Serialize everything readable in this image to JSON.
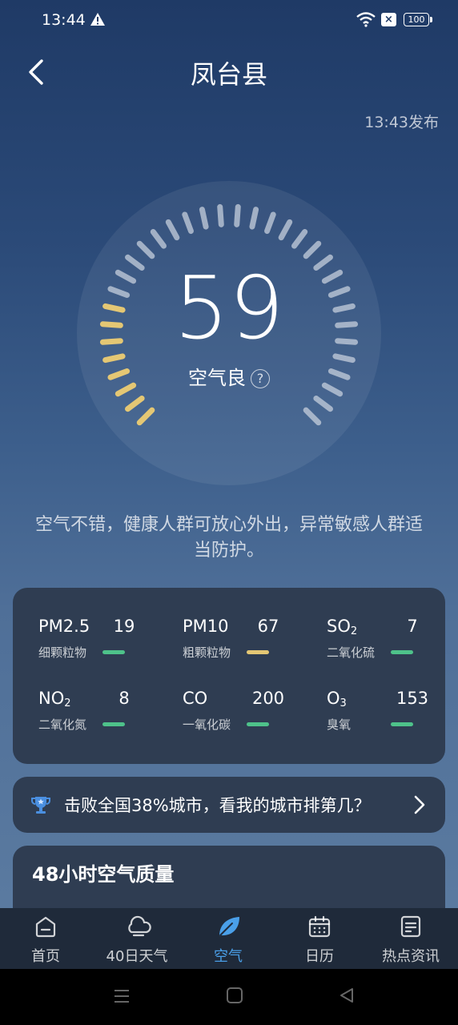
{
  "status_bar": {
    "time": "13:44",
    "battery": "100"
  },
  "header": {
    "title": "凤台县",
    "publish_time": "13:43发布"
  },
  "aqi": {
    "value": "59",
    "level": "空气良",
    "help": "?"
  },
  "advice": "空气不错，健康人群可放心外出，异常敏感人群适当防护。",
  "pollutants": [
    {
      "name": "PM2.5",
      "sub": "",
      "value": "19",
      "cn": "细颗粒物",
      "color": "#4ec28a"
    },
    {
      "name": "PM10",
      "sub": "",
      "value": "67",
      "cn": "粗颗粒物",
      "color": "#e4c774"
    },
    {
      "name": "SO",
      "sub": "2",
      "value": "7",
      "cn": "二氧化硫",
      "color": "#4ec28a"
    },
    {
      "name": "NO",
      "sub": "2",
      "value": "8",
      "cn": "二氧化氮",
      "color": "#4ec28a"
    },
    {
      "name": "CO",
      "sub": "",
      "value": "200",
      "cn": "一氧化碳",
      "color": "#4ec28a"
    },
    {
      "name": "O",
      "sub": "3",
      "value": "153",
      "cn": "臭氧",
      "color": "#4ec28a"
    }
  ],
  "rank": {
    "text": "击败全国38%城市，看我的城市排第几？"
  },
  "hours_card": {
    "title": "48小时空气质量"
  },
  "nav": [
    {
      "label": "首页",
      "icon": "home-icon"
    },
    {
      "label": "40日天气",
      "icon": "cloud-icon"
    },
    {
      "label": "空气",
      "icon": "leaf-icon"
    },
    {
      "label": "日历",
      "icon": "calendar-icon"
    },
    {
      "label": "热点资讯",
      "icon": "news-icon"
    }
  ],
  "colors": {
    "accent": "#4a9fe8",
    "good": "#4ec28a",
    "moderate": "#e4c774",
    "gauge_active": "#e4c774",
    "gauge_inactive": "#c5cfdc"
  }
}
